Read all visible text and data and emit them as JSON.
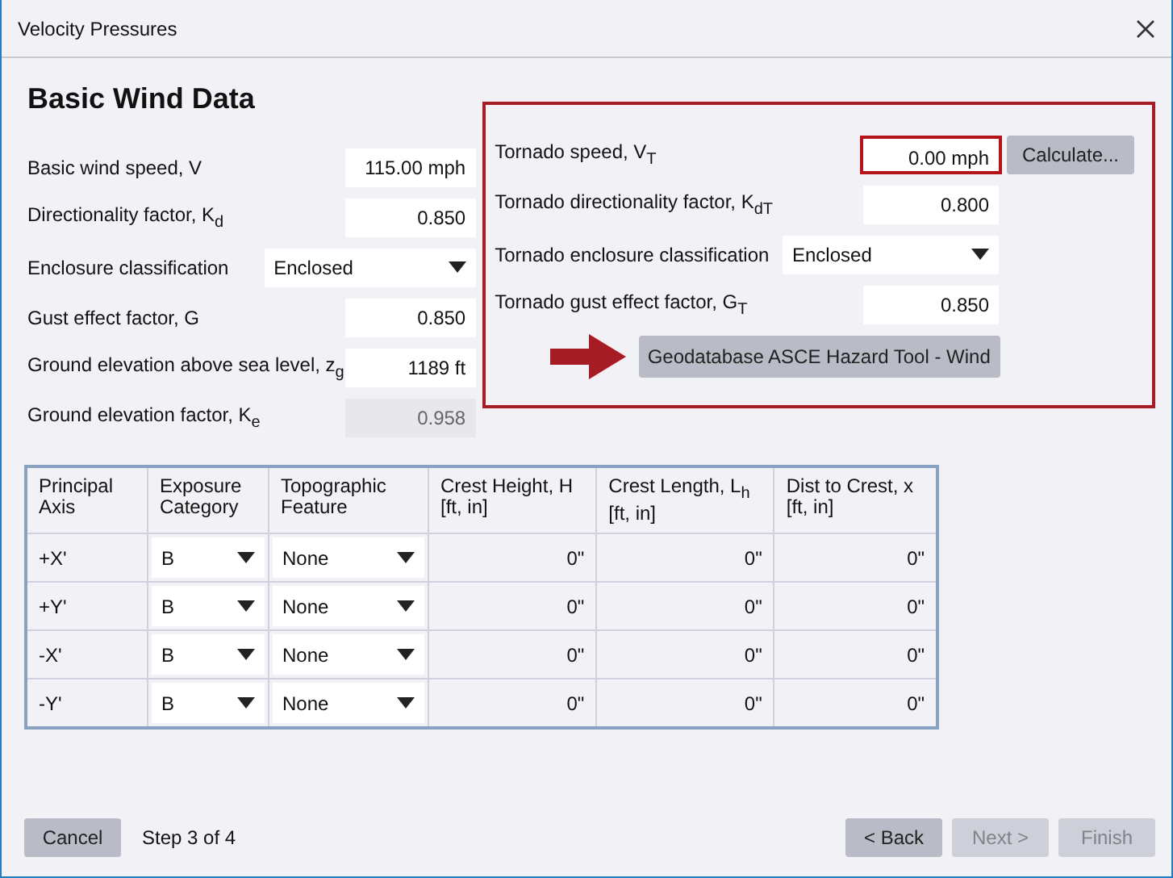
{
  "window": {
    "title": "Velocity Pressures"
  },
  "heading": "Basic Wind Data",
  "basic_fields": [
    {
      "kind": "input",
      "label": "Basic wind speed, V",
      "value": "115.00 mph",
      "disabled": false
    },
    {
      "kind": "input",
      "label": "Directionality factor, K$_{d}$",
      "value": "0.850",
      "disabled": false
    },
    {
      "kind": "dropdown",
      "label": "Enclosure classification",
      "value": "Enclosed"
    },
    {
      "kind": "input",
      "label": "Gust effect factor, G",
      "value": "0.850",
      "disabled": false
    },
    {
      "kind": "input",
      "label": "Ground elevation above sea level, z$_{g}$",
      "value": "1189 ft",
      "disabled": false
    },
    {
      "kind": "input",
      "label": "Ground elevation factor, K$_{e}$",
      "value": "0.958",
      "disabled": true
    }
  ],
  "tornado_panel": {
    "fields": [
      {
        "kind": "input",
        "label": "Tornado speed, V$_{T}$",
        "value": "0.00 mph",
        "highlighted": true
      },
      {
        "kind": "input",
        "label": "Tornado directionality factor, K$_{dT}$",
        "value": "0.800",
        "highlighted": false
      },
      {
        "kind": "dropdown",
        "label": "Tornado enclosure classification",
        "value": "Enclosed",
        "highlighted": false
      },
      {
        "kind": "input",
        "label": "Tornado gust effect factor, G$_{T}$",
        "value": "0.850",
        "highlighted": false
      }
    ],
    "calculate_button": "Calculate...",
    "hazard_tool_button": "Geodatabase ASCE Hazard Tool - Wind"
  },
  "table": {
    "columns": [
      {
        "lines": [
          "Principal",
          "Axis"
        ]
      },
      {
        "lines": [
          "Exposure",
          "Category"
        ]
      },
      {
        "lines": [
          "Topographic",
          "Feature"
        ]
      },
      {
        "lines": [
          "Crest Height, H",
          "[ft, in]"
        ]
      },
      {
        "lines": [
          "Crest Length, L$_{h}$",
          "[ft, in]"
        ]
      },
      {
        "lines": [
          "Dist to Crest, x",
          "[ft, in]"
        ]
      }
    ],
    "rows": [
      {
        "axis": "+X'",
        "exposure": "B",
        "topographic": "None",
        "crest_height": "0\"",
        "crest_length": "0\"",
        "dist_to_crest": "0\""
      },
      {
        "axis": "+Y'",
        "exposure": "B",
        "topographic": "None",
        "crest_height": "0\"",
        "crest_length": "0\"",
        "dist_to_crest": "0\""
      },
      {
        "axis": "-X'",
        "exposure": "B",
        "topographic": "None",
        "crest_height": "0\"",
        "crest_length": "0\"",
        "dist_to_crest": "0\""
      },
      {
        "axis": "-Y'",
        "exposure": "B",
        "topographic": "None",
        "crest_height": "0\"",
        "crest_length": "0\"",
        "dist_to_crest": "0\""
      }
    ]
  },
  "footer": {
    "cancel": "Cancel",
    "step": "Step 3 of 4",
    "buttons": [
      {
        "label": "< Back",
        "disabled": false
      },
      {
        "label": "Next >",
        "disabled": true
      },
      {
        "label": "Finish",
        "disabled": true
      }
    ]
  }
}
